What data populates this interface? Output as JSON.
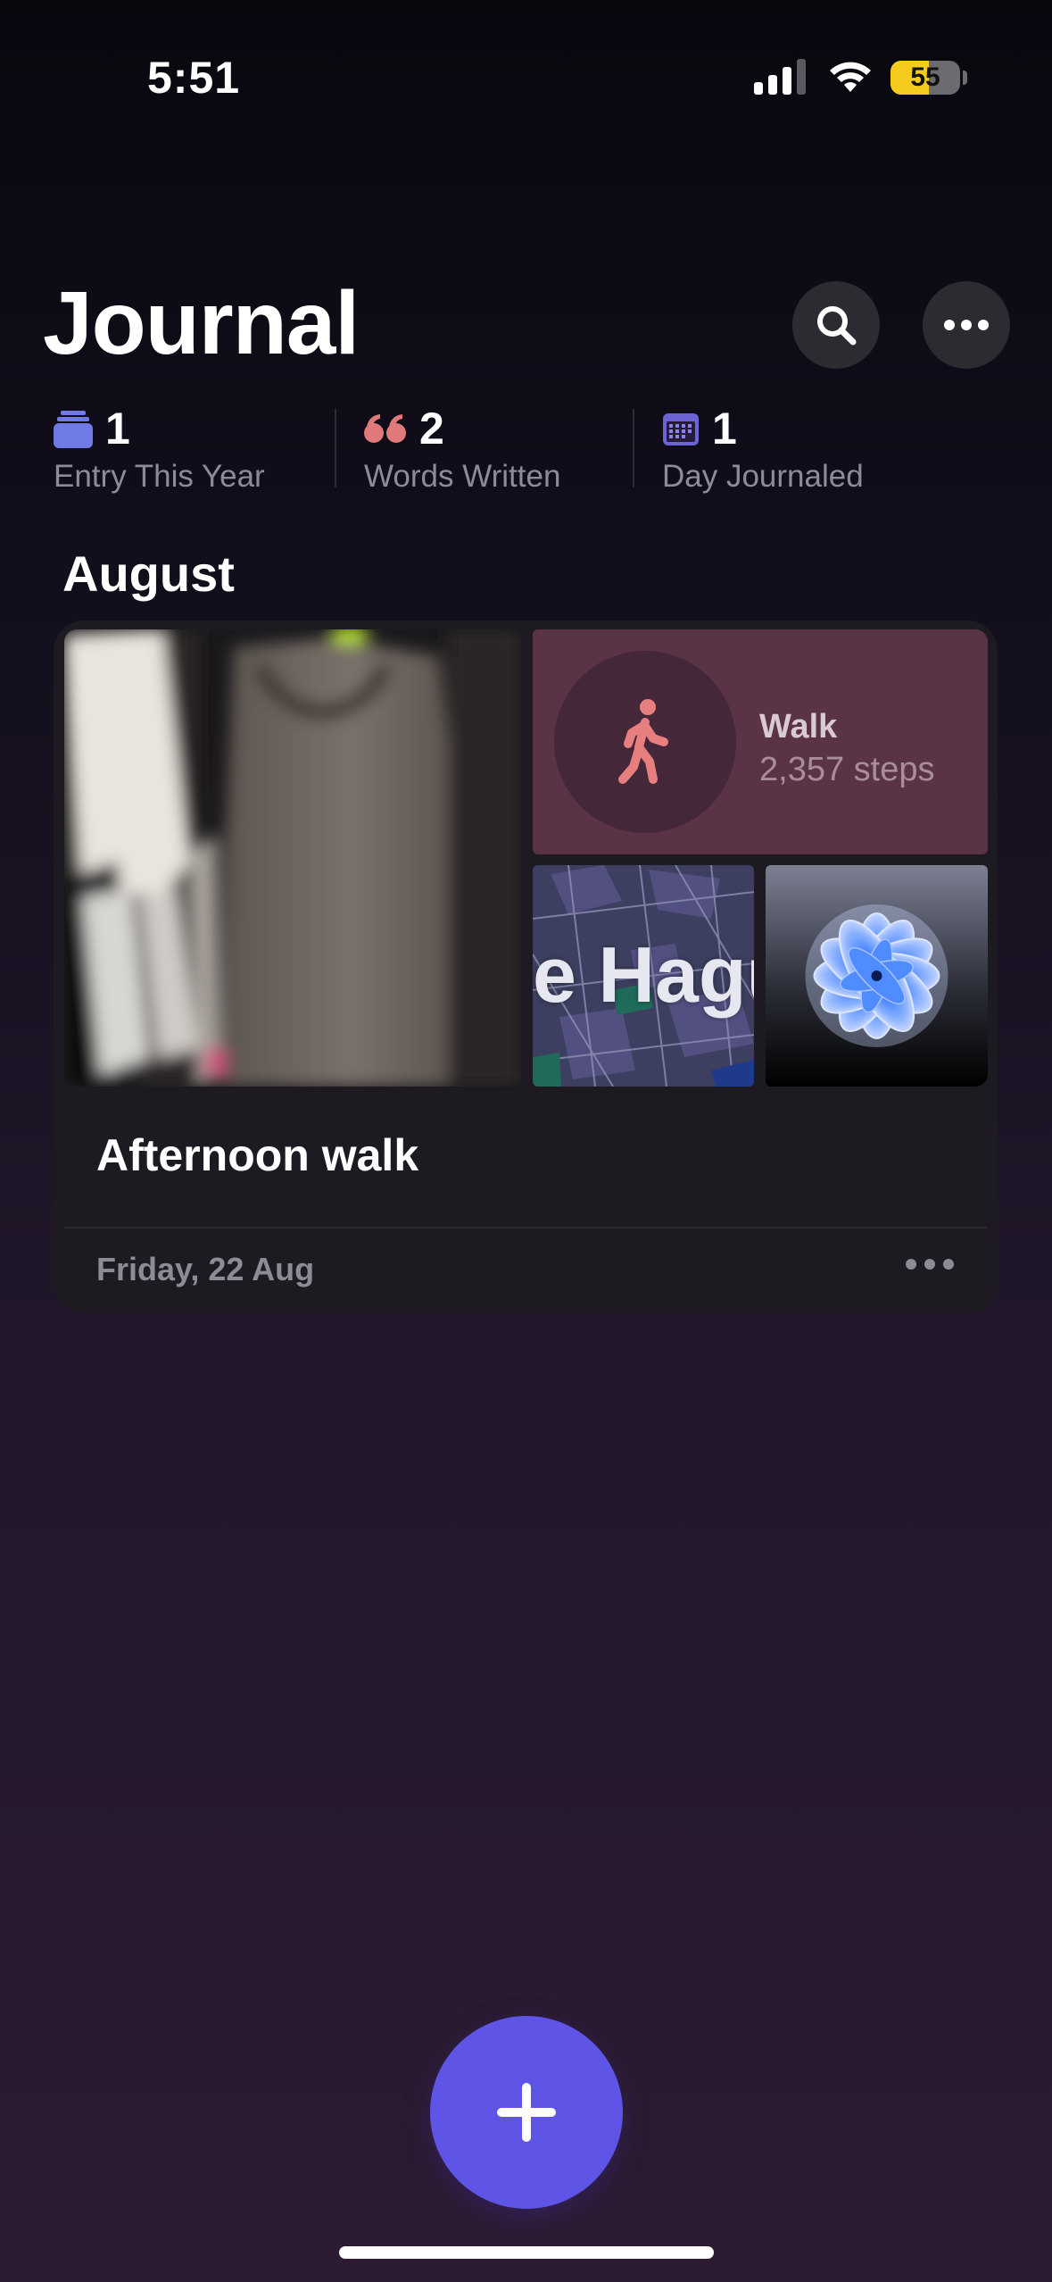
{
  "status_bar": {
    "time": "5:51",
    "battery_percent": "55",
    "battery_level": 0.55,
    "battery_color": "#f5cc1d"
  },
  "header": {
    "title": "Journal",
    "search_icon": "search-icon",
    "more_icon": "ellipsis-icon"
  },
  "stats": [
    {
      "icon": "stack-icon",
      "icon_color": "#6f7ae6",
      "value": "1",
      "label": "Entry This Year"
    },
    {
      "icon": "quote-icon",
      "icon_color": "#e07a7a",
      "value": "2",
      "label": "Words Written"
    },
    {
      "icon": "calendar-icon",
      "icon_color": "#6b63d6",
      "value": "1",
      "label": "Day Journaled"
    }
  ],
  "month": "August",
  "entry": {
    "walk": {
      "title": "Walk",
      "steps": "2,357 steps",
      "icon": "walking-figure-icon",
      "accent": "#e77f7f"
    },
    "map_label": "e Hagu",
    "title": "Afternoon walk",
    "date": "Friday, 22 Aug"
  },
  "fab_icon": "plus-icon",
  "accent_color": "#5e54e6"
}
